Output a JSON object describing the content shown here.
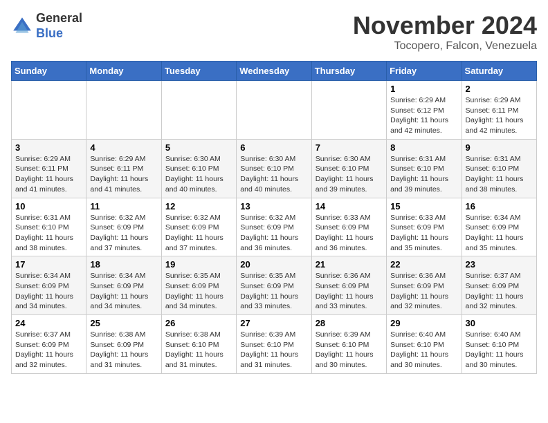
{
  "header": {
    "logo_line1": "General",
    "logo_line2": "Blue",
    "month": "November 2024",
    "location": "Tocopero, Falcon, Venezuela"
  },
  "weekdays": [
    "Sunday",
    "Monday",
    "Tuesday",
    "Wednesday",
    "Thursday",
    "Friday",
    "Saturday"
  ],
  "weeks": [
    [
      {
        "day": "",
        "info": ""
      },
      {
        "day": "",
        "info": ""
      },
      {
        "day": "",
        "info": ""
      },
      {
        "day": "",
        "info": ""
      },
      {
        "day": "",
        "info": ""
      },
      {
        "day": "1",
        "info": "Sunrise: 6:29 AM\nSunset: 6:12 PM\nDaylight: 11 hours\nand 42 minutes."
      },
      {
        "day": "2",
        "info": "Sunrise: 6:29 AM\nSunset: 6:11 PM\nDaylight: 11 hours\nand 42 minutes."
      }
    ],
    [
      {
        "day": "3",
        "info": "Sunrise: 6:29 AM\nSunset: 6:11 PM\nDaylight: 11 hours\nand 41 minutes."
      },
      {
        "day": "4",
        "info": "Sunrise: 6:29 AM\nSunset: 6:11 PM\nDaylight: 11 hours\nand 41 minutes."
      },
      {
        "day": "5",
        "info": "Sunrise: 6:30 AM\nSunset: 6:10 PM\nDaylight: 11 hours\nand 40 minutes."
      },
      {
        "day": "6",
        "info": "Sunrise: 6:30 AM\nSunset: 6:10 PM\nDaylight: 11 hours\nand 40 minutes."
      },
      {
        "day": "7",
        "info": "Sunrise: 6:30 AM\nSunset: 6:10 PM\nDaylight: 11 hours\nand 39 minutes."
      },
      {
        "day": "8",
        "info": "Sunrise: 6:31 AM\nSunset: 6:10 PM\nDaylight: 11 hours\nand 39 minutes."
      },
      {
        "day": "9",
        "info": "Sunrise: 6:31 AM\nSunset: 6:10 PM\nDaylight: 11 hours\nand 38 minutes."
      }
    ],
    [
      {
        "day": "10",
        "info": "Sunrise: 6:31 AM\nSunset: 6:10 PM\nDaylight: 11 hours\nand 38 minutes."
      },
      {
        "day": "11",
        "info": "Sunrise: 6:32 AM\nSunset: 6:09 PM\nDaylight: 11 hours\nand 37 minutes."
      },
      {
        "day": "12",
        "info": "Sunrise: 6:32 AM\nSunset: 6:09 PM\nDaylight: 11 hours\nand 37 minutes."
      },
      {
        "day": "13",
        "info": "Sunrise: 6:32 AM\nSunset: 6:09 PM\nDaylight: 11 hours\nand 36 minutes."
      },
      {
        "day": "14",
        "info": "Sunrise: 6:33 AM\nSunset: 6:09 PM\nDaylight: 11 hours\nand 36 minutes."
      },
      {
        "day": "15",
        "info": "Sunrise: 6:33 AM\nSunset: 6:09 PM\nDaylight: 11 hours\nand 35 minutes."
      },
      {
        "day": "16",
        "info": "Sunrise: 6:34 AM\nSunset: 6:09 PM\nDaylight: 11 hours\nand 35 minutes."
      }
    ],
    [
      {
        "day": "17",
        "info": "Sunrise: 6:34 AM\nSunset: 6:09 PM\nDaylight: 11 hours\nand 34 minutes."
      },
      {
        "day": "18",
        "info": "Sunrise: 6:34 AM\nSunset: 6:09 PM\nDaylight: 11 hours\nand 34 minutes."
      },
      {
        "day": "19",
        "info": "Sunrise: 6:35 AM\nSunset: 6:09 PM\nDaylight: 11 hours\nand 34 minutes."
      },
      {
        "day": "20",
        "info": "Sunrise: 6:35 AM\nSunset: 6:09 PM\nDaylight: 11 hours\nand 33 minutes."
      },
      {
        "day": "21",
        "info": "Sunrise: 6:36 AM\nSunset: 6:09 PM\nDaylight: 11 hours\nand 33 minutes."
      },
      {
        "day": "22",
        "info": "Sunrise: 6:36 AM\nSunset: 6:09 PM\nDaylight: 11 hours\nand 32 minutes."
      },
      {
        "day": "23",
        "info": "Sunrise: 6:37 AM\nSunset: 6:09 PM\nDaylight: 11 hours\nand 32 minutes."
      }
    ],
    [
      {
        "day": "24",
        "info": "Sunrise: 6:37 AM\nSunset: 6:09 PM\nDaylight: 11 hours\nand 32 minutes."
      },
      {
        "day": "25",
        "info": "Sunrise: 6:38 AM\nSunset: 6:09 PM\nDaylight: 11 hours\nand 31 minutes."
      },
      {
        "day": "26",
        "info": "Sunrise: 6:38 AM\nSunset: 6:10 PM\nDaylight: 11 hours\nand 31 minutes."
      },
      {
        "day": "27",
        "info": "Sunrise: 6:39 AM\nSunset: 6:10 PM\nDaylight: 11 hours\nand 31 minutes."
      },
      {
        "day": "28",
        "info": "Sunrise: 6:39 AM\nSunset: 6:10 PM\nDaylight: 11 hours\nand 30 minutes."
      },
      {
        "day": "29",
        "info": "Sunrise: 6:40 AM\nSunset: 6:10 PM\nDaylight: 11 hours\nand 30 minutes."
      },
      {
        "day": "30",
        "info": "Sunrise: 6:40 AM\nSunset: 6:10 PM\nDaylight: 11 hours\nand 30 minutes."
      }
    ]
  ]
}
